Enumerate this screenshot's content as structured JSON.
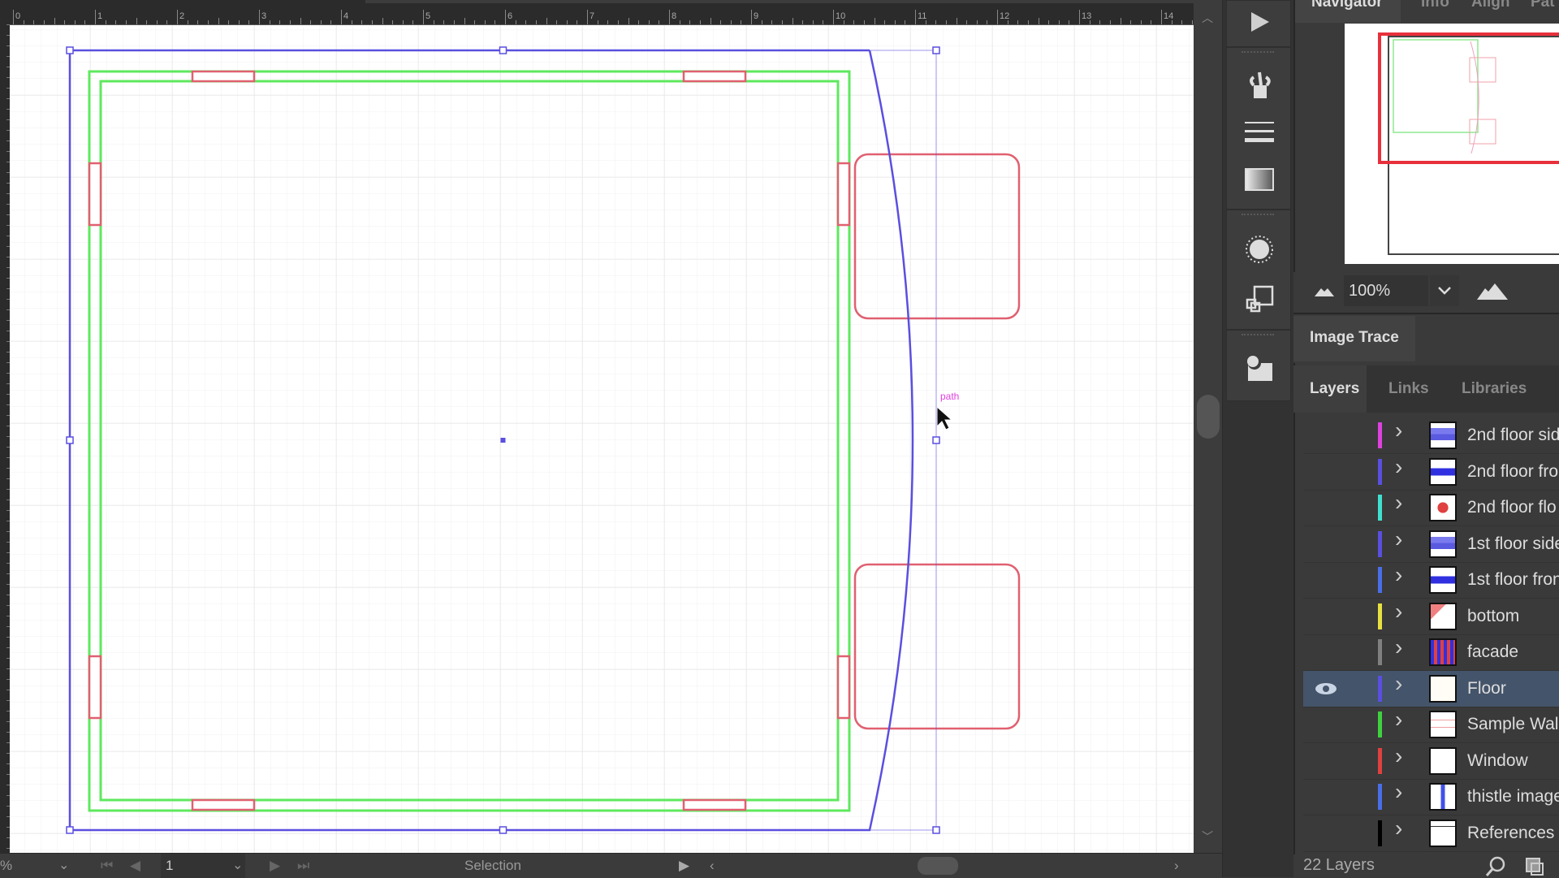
{
  "ruler": {
    "labels": [
      "0",
      "1",
      "2",
      "3",
      "4",
      "5",
      "6",
      "7",
      "8",
      "9",
      "10",
      "11",
      "12",
      "13",
      "14"
    ]
  },
  "canvas": {
    "path_label": "path",
    "colors": {
      "selection": "#5a4fe0",
      "wall": "#5ee85e",
      "window": "#e06070",
      "path_label": "#e040e0"
    }
  },
  "statusbar": {
    "zoom_value": "%",
    "page_value": "1",
    "tool_label": "Selection"
  },
  "toolstrip": {
    "icons": [
      "play-icon",
      "brush-bucket-icon",
      "stroke-lines-icon",
      "gradient-icon",
      "appearance-icon",
      "transform-icon",
      "symbol-icon"
    ]
  },
  "panel": {
    "top_tabs": [
      "Navigator",
      "Info",
      "Align",
      "Pat"
    ],
    "active_top_tab": "Navigator",
    "navigator": {
      "zoom_value": "100%"
    },
    "image_trace_label": "Image Trace",
    "layer_tabs": [
      "Layers",
      "Links",
      "Libraries"
    ],
    "active_layer_tab": "Layers",
    "layers": [
      {
        "name": "2nd floor sid",
        "color": "#e040e0",
        "visible": false,
        "selected": false
      },
      {
        "name": "2nd floor fro",
        "color": "#5a4fe0",
        "visible": false,
        "selected": false
      },
      {
        "name": "2nd floor flo",
        "color": "#40e0d0",
        "visible": false,
        "selected": false
      },
      {
        "name": "1st floor side",
        "color": "#5a4fe0",
        "visible": false,
        "selected": false
      },
      {
        "name": "1st floor fron",
        "color": "#4a6ee8",
        "visible": false,
        "selected": false
      },
      {
        "name": "bottom",
        "color": "#e8e040",
        "visible": false,
        "selected": false
      },
      {
        "name": "facade",
        "color": "#808080",
        "visible": false,
        "selected": false
      },
      {
        "name": "Floor",
        "color": "#5a4fe0",
        "visible": true,
        "selected": true
      },
      {
        "name": "Sample Wall",
        "color": "#40d040",
        "visible": false,
        "selected": false
      },
      {
        "name": "Window",
        "color": "#e04040",
        "visible": false,
        "selected": false
      },
      {
        "name": "thistle image",
        "color": "#4a6ee8",
        "visible": false,
        "selected": false
      },
      {
        "name": "References",
        "color": "#000000",
        "visible": false,
        "selected": false
      }
    ],
    "layer_count": "22 Layers"
  }
}
